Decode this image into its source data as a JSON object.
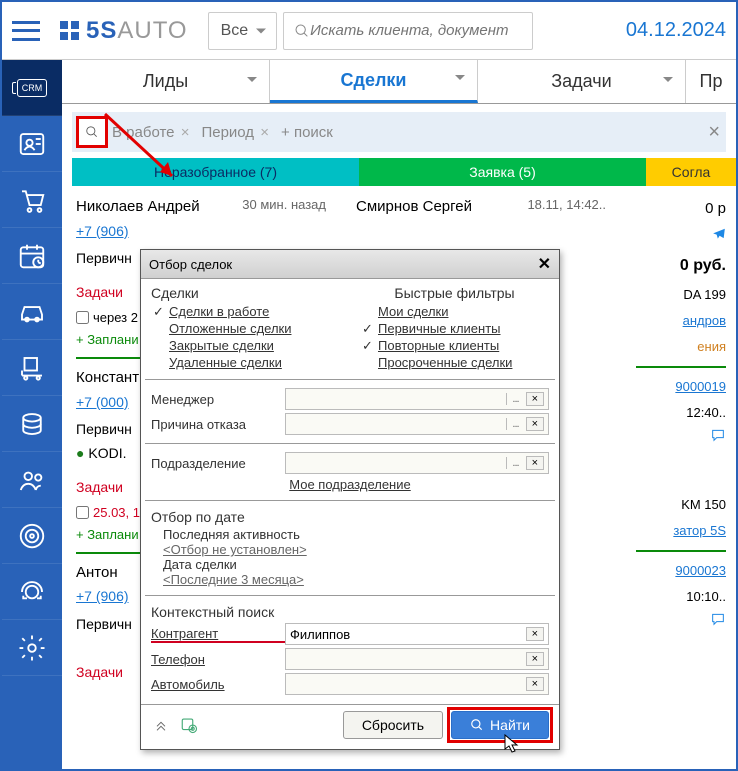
{
  "header": {
    "logo_text": "5S",
    "logo_suffix": "AUTO",
    "dropdown_all": "Все",
    "search_placeholder": "Искать клиента, документ",
    "date": "04.12.2024"
  },
  "tabs": {
    "leads": "Лиды",
    "deals": "Сделки",
    "tasks": "Задачи",
    "more": "Пр"
  },
  "filter_bar": {
    "chip1": "В работе",
    "chip2": "Период",
    "add": "+ поиск"
  },
  "pipeline": {
    "stage1": "Неразобранное (7)",
    "stage2": "Заявка (5)",
    "stage3": "Согла"
  },
  "leads": {
    "c1_name": "Николаев Андрей",
    "c1_time": "30 мин. назад",
    "c1_phone": "+7 (906)",
    "c1_primary": "Первичн",
    "c1_tasks": "Задачи",
    "c1_cb": "через 2",
    "c1_plan": "+ Заплани",
    "c2_name": "Констант",
    "c2_phone": "+7 (000)",
    "c2_primary": "Первичн",
    "c2_car": "KODI.",
    "c3_name": "Антон",
    "c4_cb": "25.03, 1",
    "col2_name": "Смирнов Сергей",
    "col2_time": "18.11, 14:42..",
    "col2_price": "0 руб.",
    "col2_amt": "0 р",
    "r_car": "DA 199",
    "r_mgr": "андров",
    "r_ed": "ения",
    "r_num1": "9000019",
    "r_time": "12:40..",
    "r_km": "KM 150",
    "r_op": "затор 5S",
    "r_num2": "9000023",
    "r_time2": "10:10.."
  },
  "dialog": {
    "title": "Отбор сделок",
    "sec_deals": "Сделки",
    "sec_fast": "Быстрые фильтры",
    "l_active": "Сделки в работе",
    "l_postponed": "Отложенные сделки",
    "l_closed": "Закрытые сделки",
    "l_deleted": "Удаленные сделки",
    "l_mydeals": "Мои сделки",
    "l_primary": "Первичные клиенты",
    "l_repeat": "Повторные клиенты",
    "l_overdue": "Просроченные сделки",
    "f_manager": "Менеджер",
    "f_reason": "Причина отказа",
    "f_division": "Подразделение",
    "l_mydiv": "Мое подразделение",
    "sec_date": "Отбор по дате",
    "sub_activity": "Последняя активность",
    "l_nofilter": "<Отбор не установлен>",
    "sub_dealdate": "Дата сделки",
    "l_last3m": "<Последние 3 месяца>",
    "sec_context": "Контекстный поиск",
    "f_counterparty": "Контрагент",
    "f_phone": "Телефон",
    "f_auto": "Автомобиль",
    "v_counterparty": "Филиппов",
    "btn_reset": "Сбросить",
    "btn_find": "Найти"
  }
}
